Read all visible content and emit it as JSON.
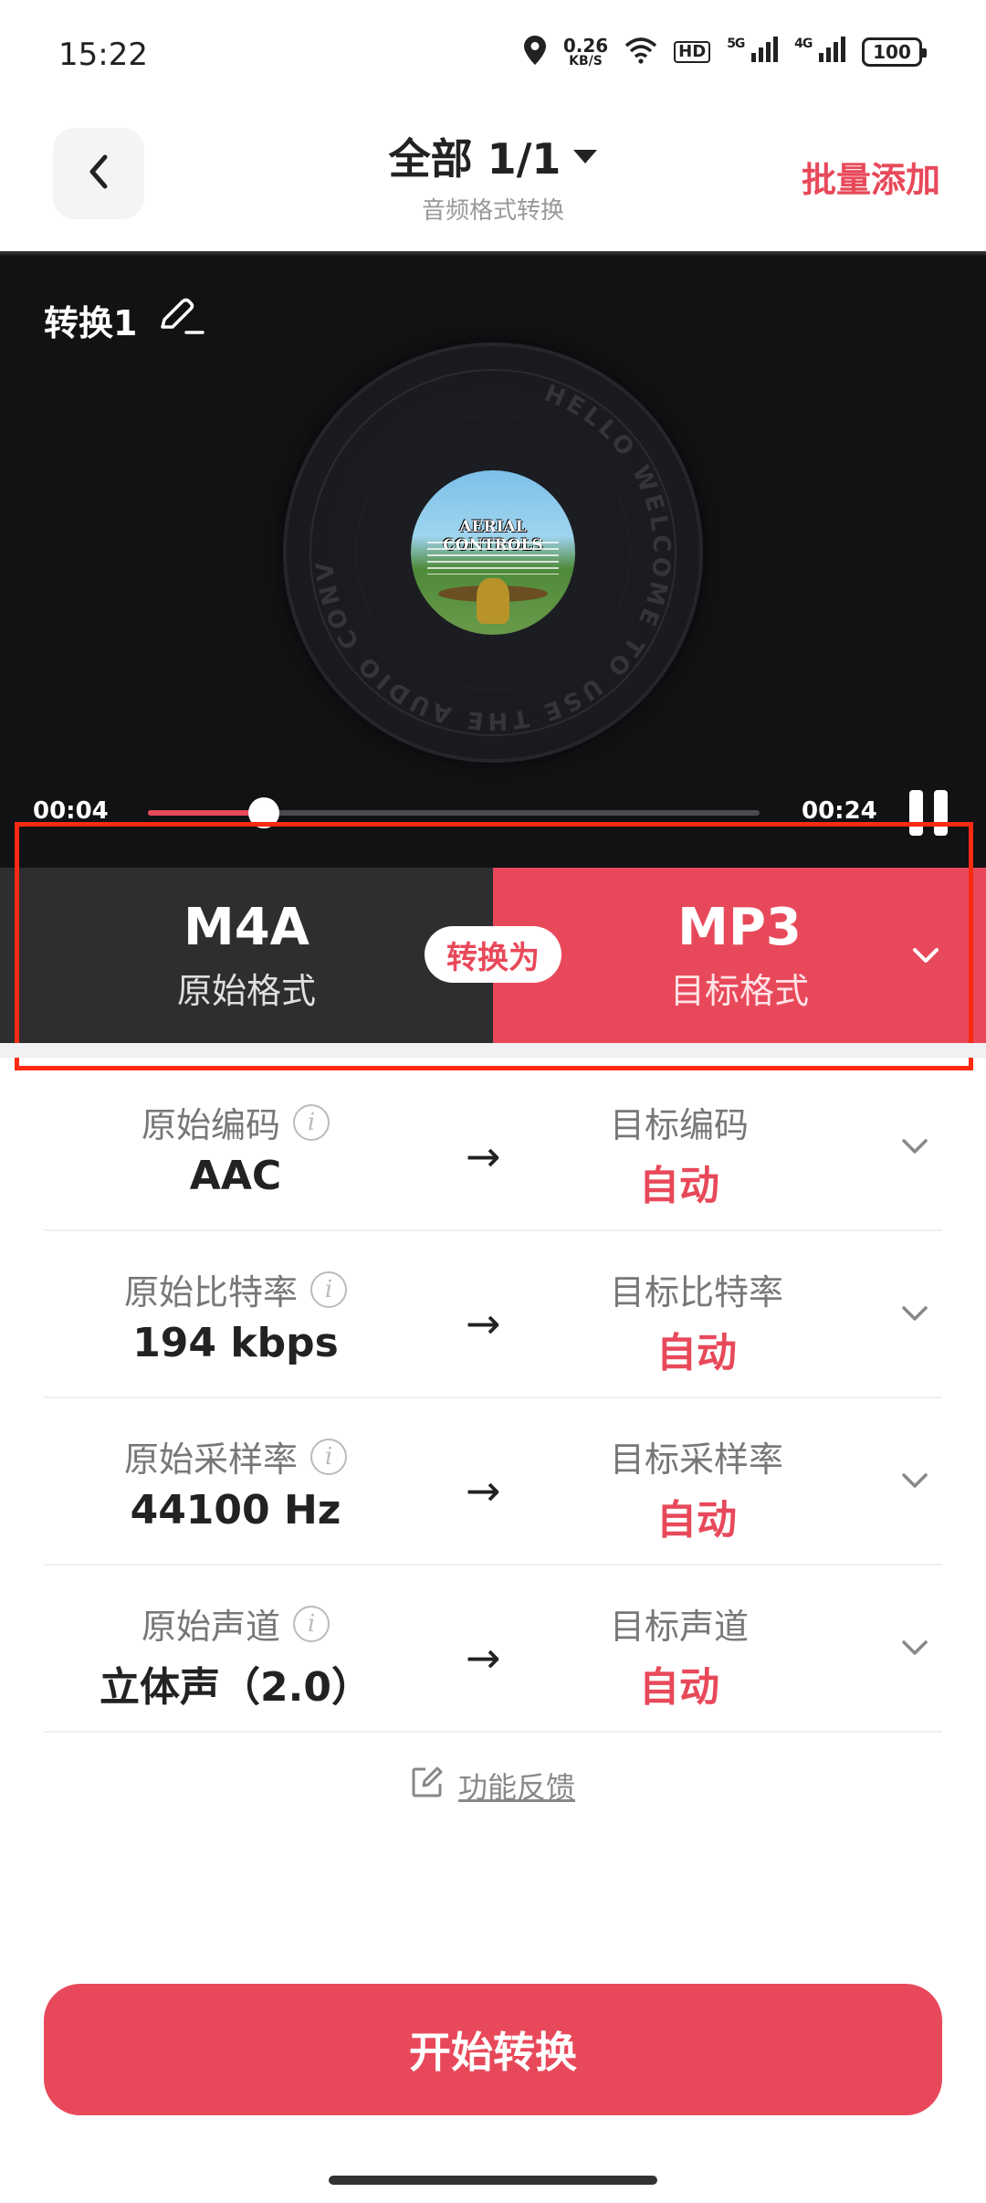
{
  "status_bar": {
    "time": "15:22",
    "net_speed_value": "0.26",
    "net_speed_unit": "KB/S",
    "hd_label": "HD",
    "signal_5g": "5G",
    "signal_4g": "4G",
    "battery": "100",
    "icons": [
      "location-icon",
      "wifi-icon",
      "hd-icon",
      "signal-5g-icon",
      "signal-4g-icon",
      "battery-icon"
    ]
  },
  "header": {
    "title": "全部 1/1",
    "subtitle": "音频格式转换",
    "batch_add": "批量添加"
  },
  "player": {
    "name": "转换1",
    "ring_text": "HELLO WELCOME TO USE THE AUDIO CONVERTER",
    "cover_title": "AERIAL CONTROLS",
    "current_time": "00:04",
    "total_time": "00:24",
    "progress": 0.19
  },
  "format": {
    "source_format": "M4A",
    "source_label": "原始格式",
    "convert_label": "转换为",
    "target_format": "MP3",
    "target_label": "目标格式"
  },
  "params": [
    {
      "source_label": "原始编码",
      "source_value": "AAC",
      "target_label": "目标编码",
      "target_value": "自动"
    },
    {
      "source_label": "原始比特率",
      "source_value": "194 kbps",
      "target_label": "目标比特率",
      "target_value": "自动"
    },
    {
      "source_label": "原始采样率",
      "source_value": "44100 Hz",
      "target_label": "目标采样率",
      "target_value": "自动"
    },
    {
      "source_label": "原始声道",
      "source_value": "立体声（2.0）",
      "target_label": "目标声道",
      "target_value": "自动"
    }
  ],
  "arrow_symbol": "→",
  "feedback": "功能反馈",
  "start_button": "开始转换",
  "colors": {
    "accent": "#e8495a",
    "dark_panel": "#2e2e31",
    "player_bg": "#111214",
    "highlight": "#ff2a12"
  }
}
